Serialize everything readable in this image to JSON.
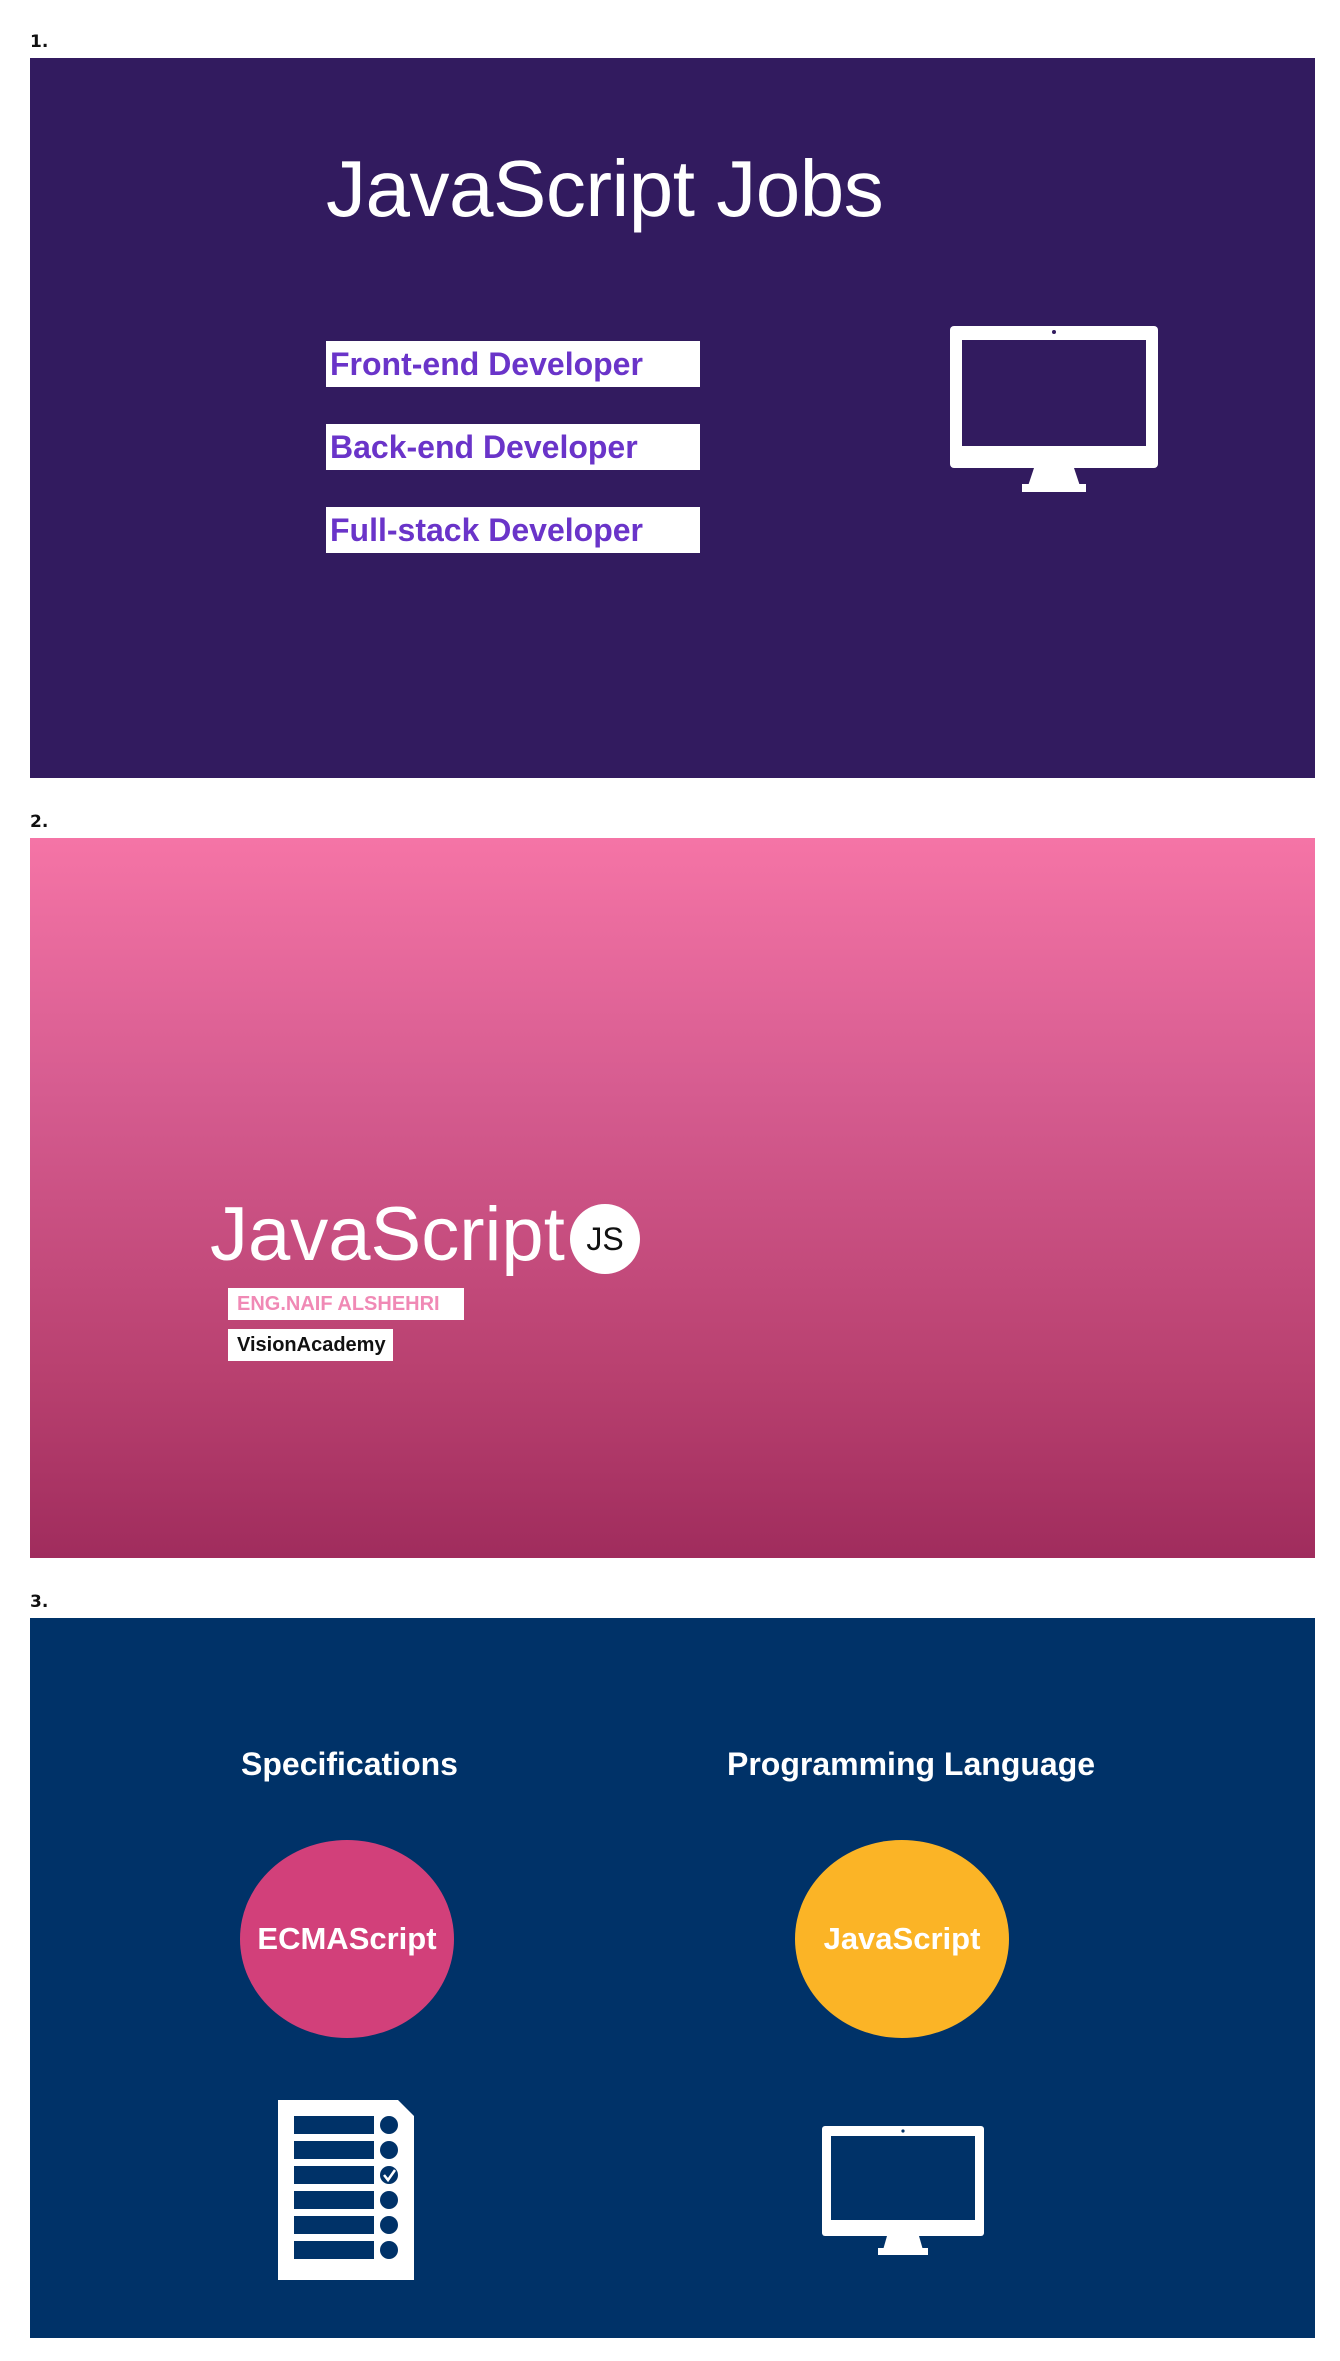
{
  "slide_numbers": [
    "1.",
    "2.",
    "3."
  ],
  "slide1": {
    "title": "JavaScript Jobs",
    "jobs": [
      "Front-end Developer",
      "Back-end Developer",
      "Full-stack Developer"
    ],
    "icon": "desktop-monitor-icon",
    "colors": {
      "background": "#321b5f",
      "accent": "#6a34c9"
    }
  },
  "slide2": {
    "title": "JavaScript",
    "badge": "JS",
    "author": "ENG.NAIF ALSHEHRI",
    "organization": "VisionAcademy",
    "colors": {
      "gradient_top": "#f574a6",
      "gradient_bottom": "#a02c5d"
    }
  },
  "slide3": {
    "left_heading": "Specifications",
    "right_heading": "Programming Language",
    "left_oval": "ECMAScript",
    "right_oval": "JavaScript",
    "left_icon": "checklist-document-icon",
    "right_icon": "desktop-monitor-icon",
    "colors": {
      "background": "#003268",
      "pink": "#d2407a",
      "yellow": "#fbb426"
    }
  }
}
